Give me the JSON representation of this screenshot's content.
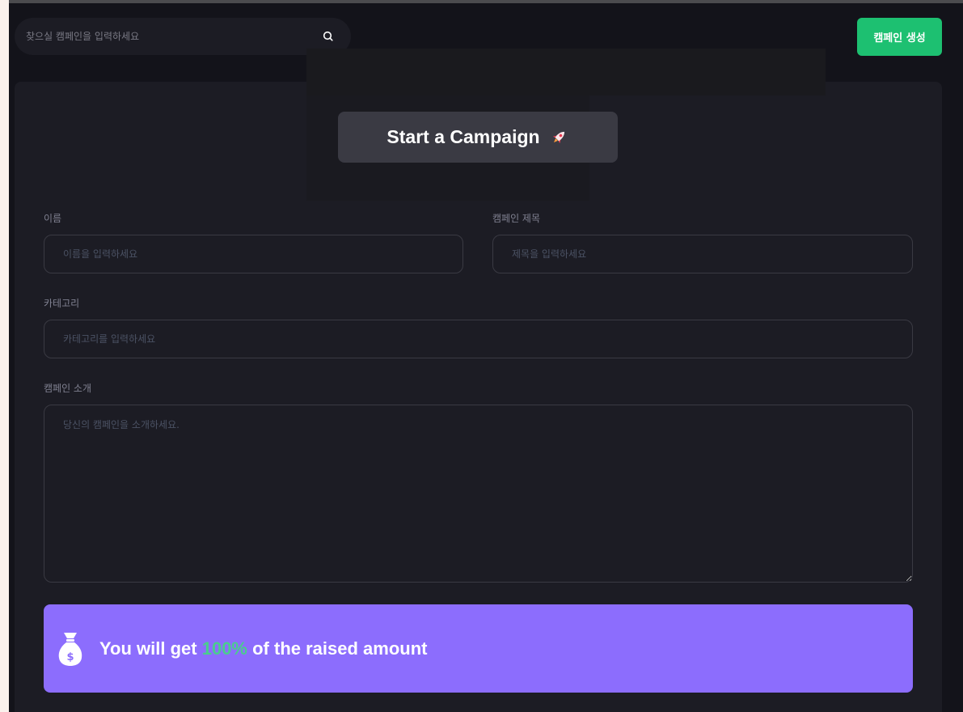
{
  "search": {
    "placeholder": "찾으실 캠페인을 입력하세요",
    "icon": "search-icon"
  },
  "header": {
    "create_label": "캠페인 생성",
    "accent": "#1dc071"
  },
  "form": {
    "title": "Start a Campaign",
    "title_icon": "rocket-icon",
    "name": {
      "label": "이름",
      "placeholder": "이름을 입력하세요"
    },
    "campaign_title": {
      "label": "캠페인 제목",
      "placeholder": "제목을 입력하세요"
    },
    "category": {
      "label": "카테고리",
      "placeholder": "카테고리를 입력하세요"
    },
    "description": {
      "label": "캠페인 소개",
      "placeholder": "당신의 캠페인을 소개하세요."
    }
  },
  "banner": {
    "icon": "money-bag-icon",
    "text_before": "You will get ",
    "percent": "100%",
    "text_after": " of the raised amount",
    "background": "#8c6dfd",
    "highlight": "#4acd8d"
  }
}
